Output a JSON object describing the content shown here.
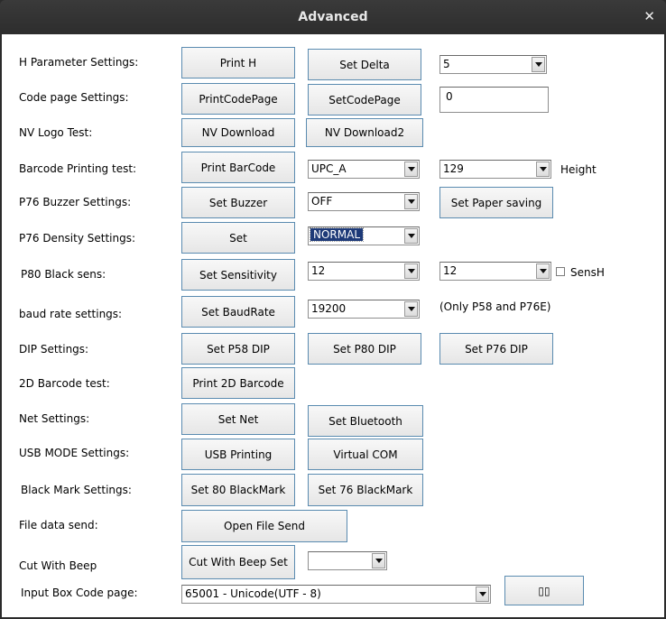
{
  "window": {
    "title": "Advanced",
    "close_icon": "✕"
  },
  "labels": {
    "h_param": "H Parameter Settings:",
    "code_page": "Code page Settings:",
    "nv_logo": "NV Logo Test:",
    "barcode": "Barcode Printing test:",
    "p76_buzzer": "P76 Buzzer Settings:",
    "p76_density": "P76 Density Settings:",
    "p80_black": "P80 Black sens:",
    "baud_rate": "baud rate settings:",
    "dip": "DIP Settings:",
    "barcode_2d": "2D Barcode test:",
    "net": "Net Settings:",
    "usb_mode": "USB MODE Settings:",
    "black_mark": "Black Mark Settings:",
    "file_send": "File data send:",
    "cut_beep": "Cut With Beep",
    "input_code_page": "Input Box Code page:",
    "height": "Height",
    "baud_note": "(Only P58 and P76E)",
    "sensh": "SensH"
  },
  "buttons": {
    "print_h": "Print H",
    "set_delta": "Set Delta",
    "print_code_page": "PrintCodePage",
    "set_code_page": "SetCodePage",
    "nv_download": "NV Download",
    "nv_download2": "NV Download2",
    "print_barcode": "Print BarCode",
    "set_buzzer": "Set Buzzer",
    "set_paper_saving": "Set Paper saving",
    "set_density": "Set",
    "set_sensitivity": "Set Sensitivity",
    "set_baud": "Set BaudRate",
    "set_p58_dip": "Set P58 DIP",
    "set_p80_dip": "Set P80 DIP",
    "set_p76_dip": "Set P76 DIP",
    "print_2d": "Print 2D Barcode",
    "set_net": "Set Net",
    "set_bluetooth": "Set Bluetooth",
    "usb_printing": "USB Printing",
    "virtual_com": "Virtual COM",
    "set80_blackmark": "Set 80 BlackMark",
    "set76_blackmark": "Set 76 BlackMark",
    "open_file_send": "Open File Send",
    "cut_beep_set": "Cut With Beep Set",
    "input_box_btn": "▯▯"
  },
  "combos": {
    "delta": "5",
    "barcode_type": "UPC_A",
    "barcode_height": "129",
    "buzzer": "OFF",
    "density": "NORMAL",
    "sens1": "12",
    "sens2": "12",
    "baud": "19200",
    "cut_beep": "",
    "input_code_page": "65001 - Unicode(UTF - 8)"
  },
  "inputs": {
    "code_page_value": "0"
  },
  "checkboxes": {
    "sensh_checked": false
  }
}
